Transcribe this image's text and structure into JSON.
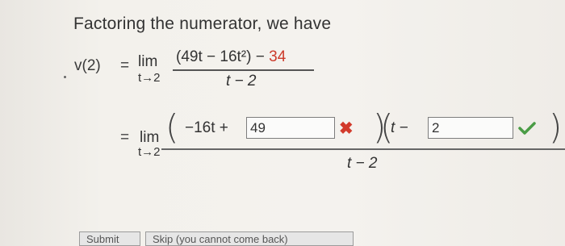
{
  "intro_text": "Factoring the numerator, we have",
  "expression1": {
    "lhs": "v(2)",
    "equals": "=",
    "lim": "lim",
    "lim_sub": "t→2",
    "numerator_main": "(49t − 16t²)",
    "numerator_minus": "−",
    "numerator_value": "34",
    "denominator": "t − 2"
  },
  "expression2": {
    "equals": "=",
    "lim": "lim",
    "lim_sub": "t→2",
    "left_paren": "(",
    "first_term": "−16t +",
    "answer1": "49",
    "answer1_status": "incorrect",
    "middle_close_paren": ")",
    "middle_open_paren": "(",
    "t_minus": "t −",
    "answer2": "2",
    "answer2_status": "correct",
    "right_paren": ")",
    "denominator": "t − 2"
  },
  "buttons": {
    "submit": "Submit",
    "skip": "Skip (you cannot come back)"
  },
  "colors": {
    "incorrect": "#d23a2b",
    "correct": "#4a9c45",
    "accent_red": "#cc3b2b"
  },
  "icons": {
    "incorrect": "x-mark-icon",
    "correct": "checkmark-icon"
  }
}
